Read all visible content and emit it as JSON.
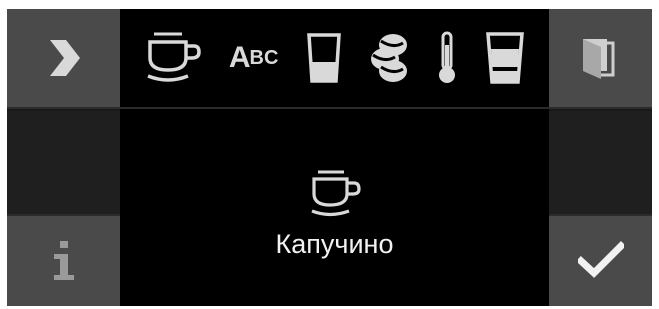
{
  "toolbar": {
    "items": [
      {
        "name": "cup-icon"
      },
      {
        "name": "name-edit-abc",
        "label_big": "A",
        "label_small": "BC"
      },
      {
        "name": "quantity-glass-icon"
      },
      {
        "name": "coffee-bean-strength-icon"
      },
      {
        "name": "temperature-icon"
      },
      {
        "name": "milk-glass-icon"
      }
    ]
  },
  "sidebar_left": {
    "top_button_icon": "chevron-right-icon",
    "bottom_button_icon": "info-icon",
    "bottom_button_label": "i"
  },
  "sidebar_right": {
    "top_button_icon": "book-exit-icon",
    "bottom_button_icon": "checkmark-icon"
  },
  "content": {
    "drink_icon": "cup-icon",
    "drink_name": "Капучино"
  },
  "colors": {
    "background": "#000000",
    "button_bg": "#4a4a4a",
    "icon": "#d9d9d9"
  }
}
